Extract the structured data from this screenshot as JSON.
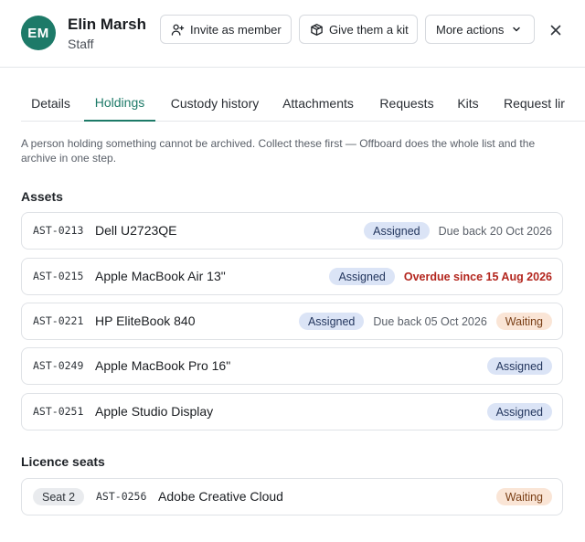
{
  "person": {
    "initials": "EM",
    "name": "Elin Marsh",
    "role": "Staff"
  },
  "actions": {
    "invite_label": "Invite as member",
    "kit_label": "Give them a kit",
    "more_label": "More actions",
    "close_icon": "close-icon"
  },
  "tabs": [
    {
      "label": "Details",
      "active": false
    },
    {
      "label": "Holdings",
      "active": true
    },
    {
      "label": "Custody history",
      "active": false
    },
    {
      "label": "Attachments",
      "active": false
    },
    {
      "label": "Requests",
      "active": false
    },
    {
      "label": "Kits",
      "active": false
    },
    {
      "label": "Request lir",
      "active": false
    }
  ],
  "notice": "A person holding something cannot be archived. Collect these first — Offboard does the whole list and the archive in one step.",
  "assets": {
    "title": "Assets",
    "items": [
      {
        "code": "AST-0213",
        "name": "Dell U2723QE",
        "status": "Assigned",
        "due": "Due back 20 Oct 2026",
        "overdue": false,
        "extra": ""
      },
      {
        "code": "AST-0215",
        "name": "Apple MacBook Air 13\"",
        "status": "Assigned",
        "due": "Overdue since 15 Aug 2026",
        "overdue": true,
        "extra": ""
      },
      {
        "code": "AST-0221",
        "name": "HP EliteBook 840",
        "status": "Assigned",
        "due": "Due back 05 Oct 2026",
        "overdue": false,
        "extra": "Waiting"
      },
      {
        "code": "AST-0249",
        "name": "Apple MacBook Pro 16\"",
        "status": "Assigned",
        "due": "",
        "overdue": false,
        "extra": ""
      },
      {
        "code": "AST-0251",
        "name": "Apple Studio Display",
        "status": "Assigned",
        "due": "",
        "overdue": false,
        "extra": ""
      }
    ]
  },
  "licences": {
    "title": "Licence seats",
    "items": [
      {
        "seat": "Seat 2",
        "code": "AST-0256",
        "name": "Adobe Creative Cloud",
        "status": "Waiting"
      }
    ]
  },
  "colors": {
    "accent": "#1d7a68",
    "assigned_bg": "#dbe4f6",
    "waiting_bg": "#fae5d6",
    "overdue": "#b3261e"
  }
}
